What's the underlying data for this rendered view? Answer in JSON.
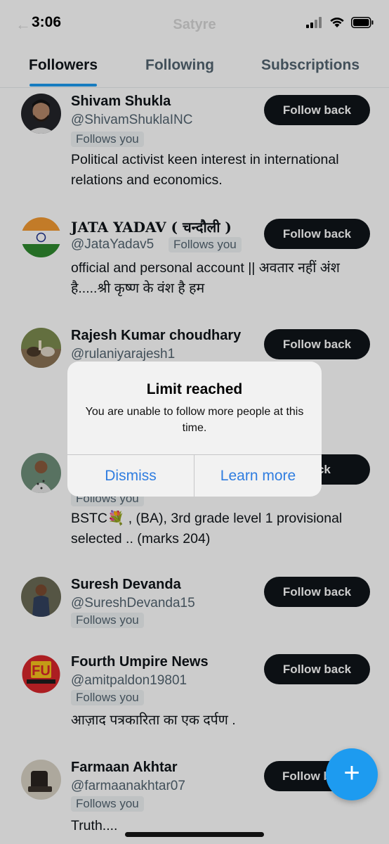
{
  "status_bar": {
    "time": "3:06"
  },
  "header": {
    "title": "Satyre"
  },
  "tabs": [
    {
      "label": "Followers",
      "active": true
    },
    {
      "label": "Following",
      "active": false
    },
    {
      "label": "Subscriptions",
      "active": false
    }
  ],
  "users": [
    {
      "name": "Shivam Shukla",
      "handle": "@ShivamShuklaINC",
      "badge": "Follows you",
      "bio": "Political activist keen interest in international relations and economics.",
      "button": "Follow back"
    },
    {
      "name": "JATA YADAV ( चन्दौली )",
      "handle": "@JataYadav5",
      "badge": "Follows you",
      "bio": "official and personal account || अवतार नहीं अंश है.....श्री कृष्ण के वंश है हम",
      "button": "Follow back"
    },
    {
      "name": "Rajesh Kumar choudhary",
      "handle": "@rulaniyarajesh1",
      "badge": "",
      "bio": "",
      "button": "Follow back"
    },
    {
      "name": "",
      "handle": "",
      "badge": "Follows you",
      "bio": "BSTC💐 , (BA), 3rd grade level 1 provisional selected .. (marks 204)",
      "button": "back"
    },
    {
      "name": "Suresh Devanda",
      "handle": "@SureshDevanda15",
      "badge": "Follows you",
      "bio": "",
      "button": "Follow back"
    },
    {
      "name": "Fourth Umpire News",
      "handle": "@amitpaldon19801",
      "badge": "Follows you",
      "bio": "आज़ाद पत्रकारिता का एक दर्पण .",
      "button": "Follow back"
    },
    {
      "name": "Farmaan Akhtar",
      "handle": "@farmaanakhtar07",
      "badge": "Follows you",
      "bio": "Truth....",
      "button": "Follow b"
    }
  ],
  "alert": {
    "title": "Limit reached",
    "message": "You are unable to follow more people at this time.",
    "dismiss": "Dismiss",
    "learn_more": "Learn more"
  },
  "fab": {
    "icon": "plus-icon"
  },
  "colors": {
    "accent": "#1d9bf0",
    "button_bg": "#0f1419",
    "alert_link": "#2f7de0"
  }
}
